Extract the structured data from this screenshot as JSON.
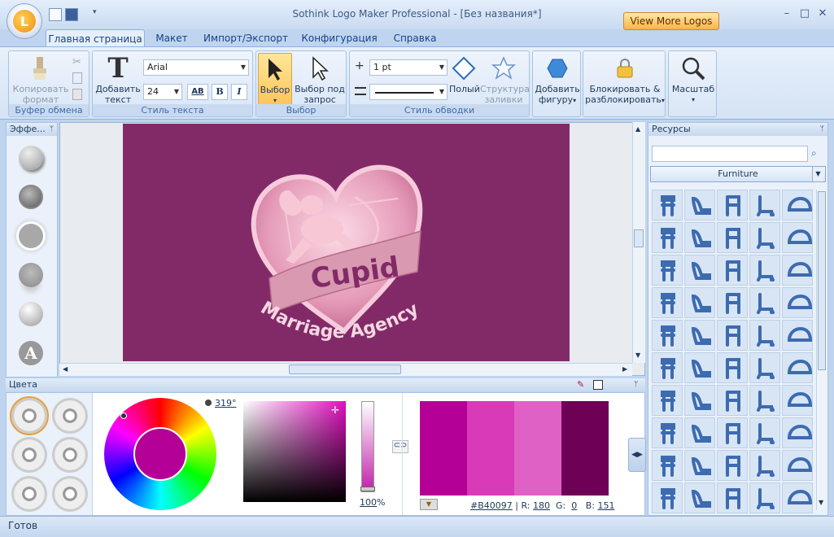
{
  "window": {
    "title": "Sothink Logo Maker Professional - [Без названия*]",
    "more_logos": "View More Logos"
  },
  "tabs": [
    {
      "label": "Главная страница"
    },
    {
      "label": "Макет"
    },
    {
      "label": "Импорт/Экспорт"
    },
    {
      "label": "Конфигурация"
    },
    {
      "label": "Справка"
    }
  ],
  "ribbon": {
    "clipboard": {
      "label": "Буфер обмена",
      "copy_format": "Копировать формат"
    },
    "text_style": {
      "label": "Стиль текста",
      "add_text": "Добавить текст",
      "font": "Arial",
      "size": "24",
      "ab_label": "AB",
      "bold": "B",
      "italic": "I"
    },
    "select": {
      "label": "Выбор",
      "select": "Выбор",
      "subselect": "Выбор под запрос"
    },
    "stroke": {
      "label": "Стиль обводки",
      "width": "1 pt",
      "fill": "Полый",
      "fill_struct": "Структура заливки"
    },
    "add_shape": "Добавить фигуру",
    "lock": "Блокировать & разблокировать",
    "zoom": "Масштаб"
  },
  "effects": {
    "title": "Эффе..."
  },
  "logo": {
    "title": "Cupid",
    "subtitle": "Marriage Agency"
  },
  "colors": {
    "title": "Цвета",
    "hue": "319°",
    "opacity": "100",
    "percent": "%",
    "hex": "#B40097",
    "r_label": "R:",
    "r": "180",
    "g_label": "G:",
    "g": "0",
    "b_label": "B:",
    "b": "151",
    "palette": [
      "#b40097",
      "#d83ab8",
      "#e061c6",
      "#6e0055"
    ],
    "wheel_center": "#b40097"
  },
  "resources": {
    "title": "Ресурсы",
    "search_placeholder": "",
    "category": "Furniture"
  },
  "status": {
    "text": "Готов"
  },
  "theme": {
    "accent": "#15428b",
    "ribbon_bg": "#d4e3f5",
    "artboard": "#822a68",
    "icon_blue": "#3d6bb0"
  }
}
